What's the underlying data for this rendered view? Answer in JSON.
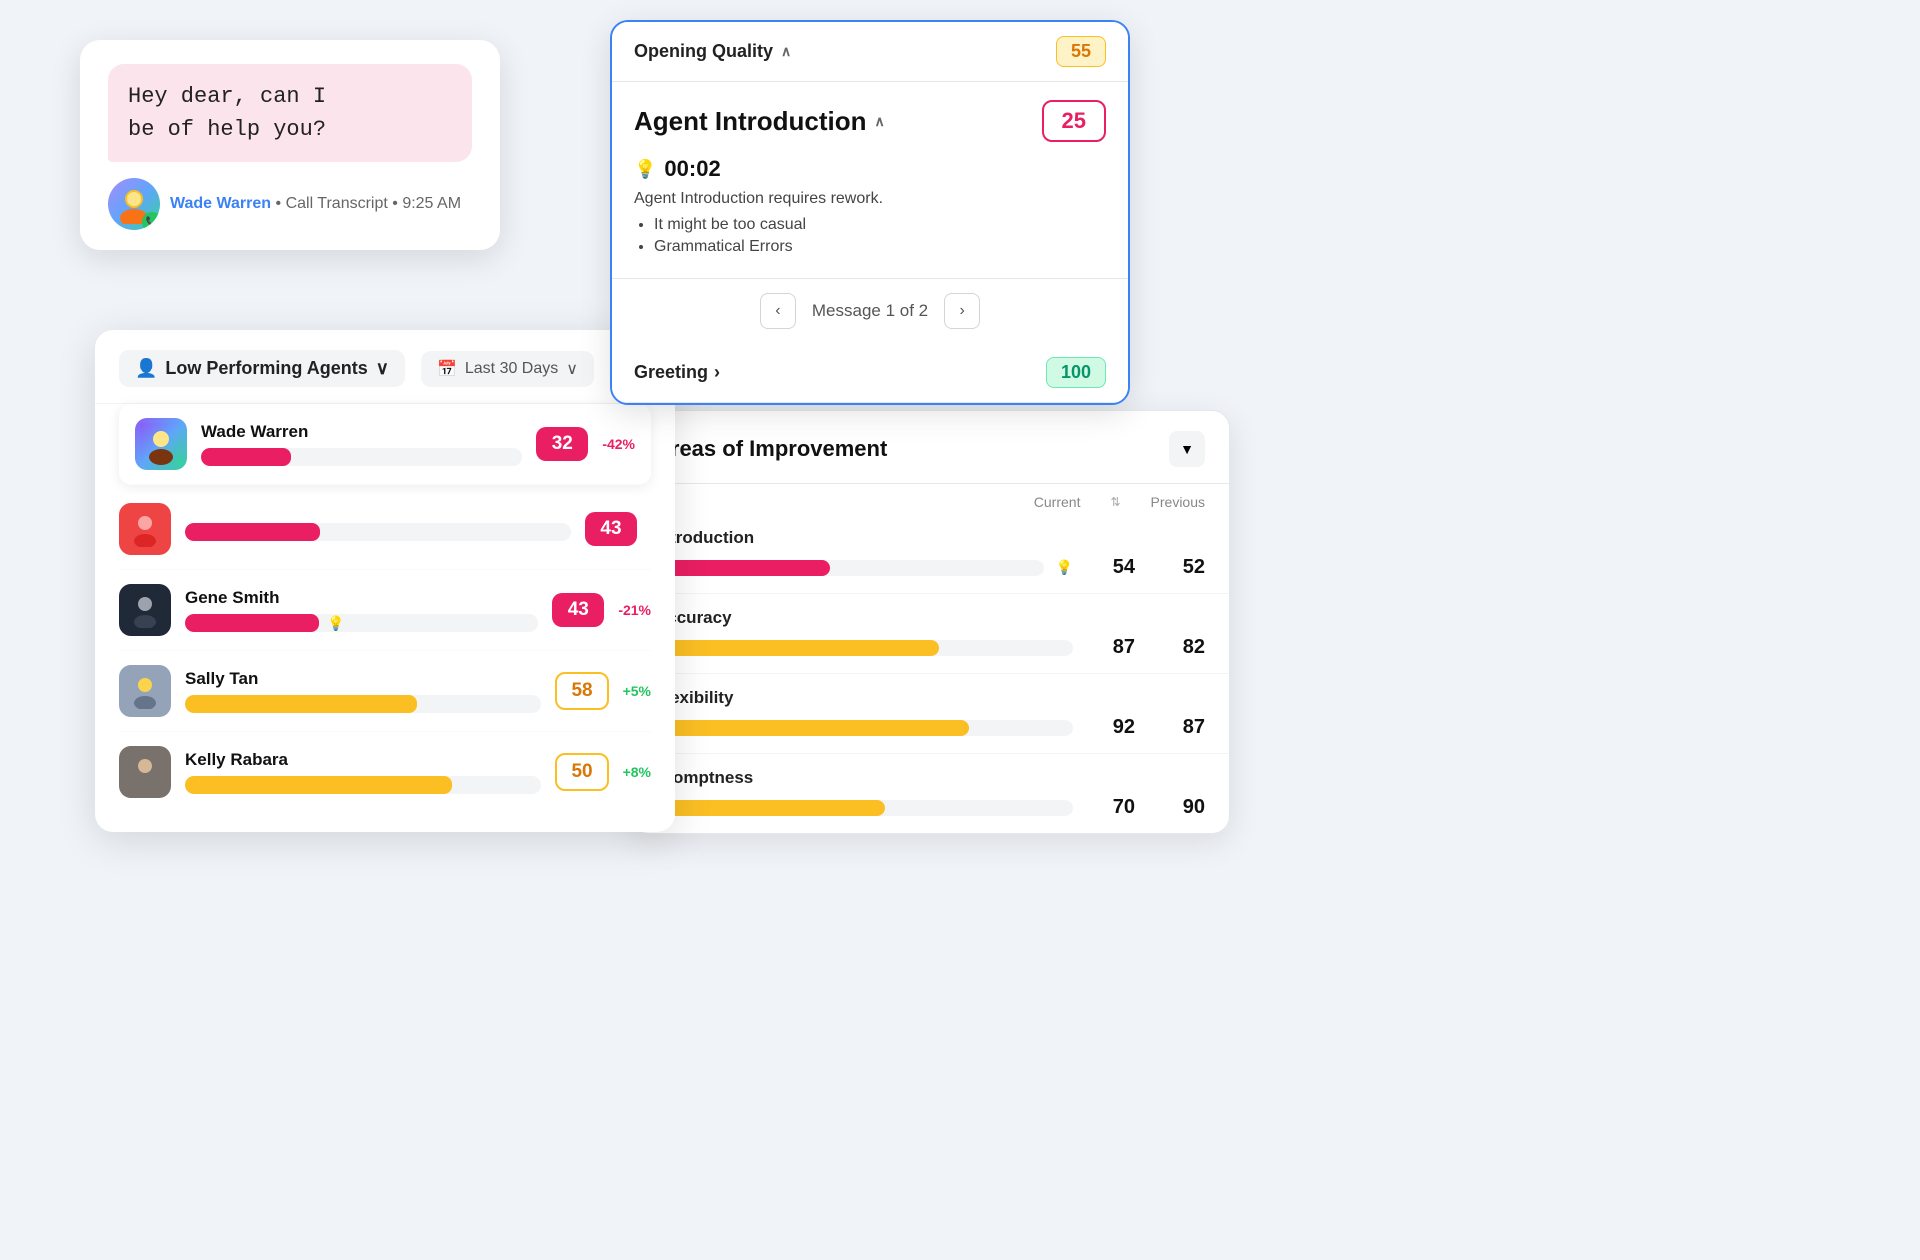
{
  "chat": {
    "bubble_text_line1": "Hey dear, can I",
    "bubble_text_line2": "be of help you?",
    "agent_name": "Wade Warren",
    "meta_separator": " • ",
    "call_transcript": "Call Transcript",
    "time": "9:25 AM"
  },
  "agent_intro_card": {
    "opening_quality_label": "Opening Quality",
    "opening_quality_chevron": "∧",
    "opening_quality_score": "55",
    "title": "Agent Introduction",
    "title_chevron": "∧",
    "score": "25",
    "timestamp": "00:02",
    "rework_text": "Agent Introduction requires rework.",
    "bullet1": "It might be too casual",
    "bullet2": "Grammatical Errors",
    "message_label": "Message 1 of 2",
    "prev_arrow": "‹",
    "next_arrow": "›",
    "greeting_label": "Greeting",
    "greeting_chevron": "›",
    "greeting_score": "100"
  },
  "low_perf": {
    "title": "Low Performing Agents",
    "title_chevron": "∨",
    "date_filter": "Last 30 Days",
    "date_chevron": "∨",
    "calendar_icon": "📅",
    "agents": [
      {
        "name": "Wade Warren",
        "bar_width": "28%",
        "bar_type": "pink",
        "score": "32",
        "score_type": "pink",
        "change": "-42%",
        "change_type": "neg",
        "show_bulb": false
      },
      {
        "name": "",
        "bar_width": "35%",
        "bar_type": "pink",
        "score": "43",
        "score_type": "pink",
        "change": "",
        "change_type": "",
        "show_bulb": false
      },
      {
        "name": "Gene Smith",
        "bar_width": "38%",
        "bar_type": "pink",
        "score": "43",
        "score_type": "pink",
        "change": "-21%",
        "change_type": "neg",
        "show_bulb": true
      },
      {
        "name": "Sally Tan",
        "bar_width": "65%",
        "bar_type": "yellow",
        "score": "58",
        "score_type": "yellow",
        "change": "+5%",
        "change_type": "pos",
        "show_bulb": false
      },
      {
        "name": "Kelly Rabara",
        "bar_width": "75%",
        "bar_type": "yellow",
        "score": "50",
        "score_type": "yellow",
        "change": "+8%",
        "change_type": "pos",
        "show_bulb": false
      }
    ]
  },
  "areas": {
    "title": "Areas of Improvement",
    "filter_icon": "▼",
    "col_current": "Current",
    "col_sort_icon": "⇅",
    "col_previous": "Previous",
    "metrics": [
      {
        "label": "Introduction",
        "bar_type": "pink",
        "bar_width": "45%",
        "current": "54",
        "previous": "52",
        "show_bulb": true
      },
      {
        "label": "Accuracy",
        "bar_type": "yellow",
        "bar_width": "68%",
        "current": "87",
        "previous": "82",
        "show_bulb": false
      },
      {
        "label": "Flexibility",
        "bar_type": "yellow",
        "bar_width": "75%",
        "current": "92",
        "previous": "87",
        "show_bulb": false
      },
      {
        "label": "Promptness",
        "bar_type": "yellow",
        "bar_width": "55%",
        "current": "70",
        "previous": "90",
        "show_bulb": false
      }
    ]
  },
  "colors": {
    "pink": "#e91e63",
    "yellow": "#fbbf24",
    "green": "#22c55e",
    "blue": "#3b82f6"
  }
}
